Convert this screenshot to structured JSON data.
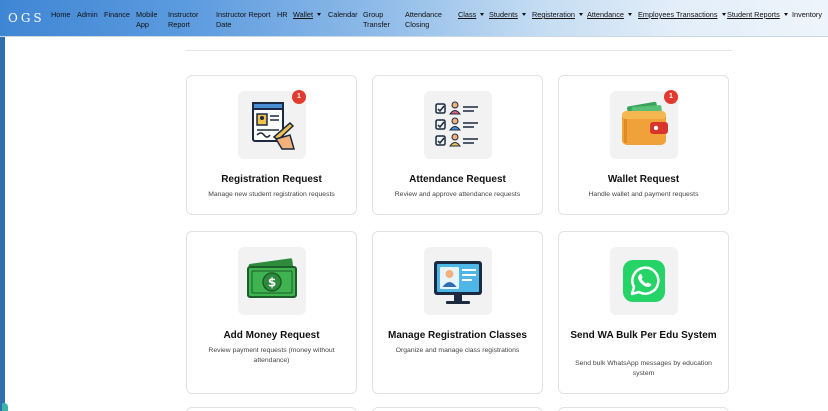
{
  "navbar": {
    "brand": "OGS",
    "items": [
      {
        "label": "Home"
      },
      {
        "label": "Admin"
      },
      {
        "label": "Finance"
      },
      {
        "label": "Mobile App"
      },
      {
        "label": "Instructor Report"
      },
      {
        "label": "Instructor Report Date"
      },
      {
        "label": "HR"
      },
      {
        "label": "Wallet"
      },
      {
        "label": "Calendar"
      },
      {
        "label": "Group Transfer"
      },
      {
        "label": "Attendance Closing"
      },
      {
        "label": "Class"
      },
      {
        "label": "Students"
      },
      {
        "label": "Registeration"
      },
      {
        "label": "Attendance"
      },
      {
        "label": "Employees Transactions"
      },
      {
        "label": "Student Reports"
      },
      {
        "label": "Inventory"
      }
    ]
  },
  "cards": [
    {
      "title": "Registration Request",
      "description": "Manage new student registration requests",
      "badge": "1",
      "icon": "registration-document-icon"
    },
    {
      "title": "Attendance Request",
      "description": "Review and approve attendance requests",
      "icon": "attendance-checklist-icon"
    },
    {
      "title": "Wallet Request",
      "description": "Handle wallet and payment requests",
      "badge": "1",
      "icon": "wallet-icon"
    },
    {
      "title": "Add Money Request",
      "description": "Review payment requests (money without attendance)",
      "icon": "money-bill-icon"
    },
    {
      "title": "Manage Registration Classes",
      "description": "Organize and manage class registrations",
      "icon": "computer-profile-icon"
    },
    {
      "title": "Send WA Bulk Per Edu System",
      "description": "Send bulk WhatsApp messages by education system",
      "icon": "whatsapp-icon"
    }
  ],
  "colors": {
    "badge": "#e23a2f",
    "navbar_start": "#3f86d4",
    "navbar_end": "#eef4fb"
  }
}
